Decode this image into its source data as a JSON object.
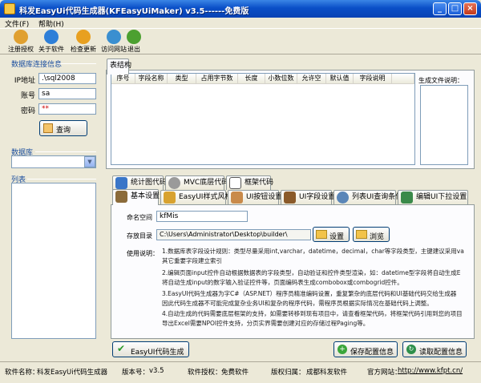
{
  "window": {
    "title": "科发EasyUi代码生成器(KFEasyUiMaker) v3.5------免费版",
    "min_glyph": "_",
    "max_glyph": "□",
    "close_glyph": "×"
  },
  "menu": {
    "items": [
      "文件(F)",
      "帮助(H)"
    ]
  },
  "toolbar": {
    "items": [
      {
        "label": "注册授权",
        "icon": "key-icon",
        "color": "#e0a030"
      },
      {
        "label": "关于软件",
        "icon": "help-icon",
        "color": "#2e7fd8"
      },
      {
        "label": "检查更新",
        "icon": "update-icon",
        "color": "#e8a020"
      },
      {
        "label": "访问网站",
        "icon": "globe-icon",
        "color": "#3a8fd0"
      },
      {
        "label": "退出",
        "icon": "exit-icon",
        "color": "#4ca030"
      }
    ]
  },
  "connection": {
    "group_title": "数据库连接信息",
    "ip_label": "IP地址",
    "ip_value": ".\\sql2008",
    "account_label": "账号",
    "account_value": "sa",
    "password_label": "密码",
    "password_value": "**",
    "query_button": "查询"
  },
  "database": {
    "group_title": "数据库",
    "selected": ""
  },
  "tables": {
    "group_title": "列表"
  },
  "table_structure": {
    "tab_label": "表结构",
    "columns": [
      "序号",
      "字段名称",
      "类型",
      "占用字节数",
      "长度",
      "小数位数",
      "允许空",
      "默认值",
      "字段说明"
    ]
  },
  "generated_files": {
    "label": "生成文件说明："
  },
  "tabs_row1": [
    {
      "label": "统计图代码",
      "icon": "chart-icon"
    },
    {
      "label": "MVC底层代码",
      "icon": "gear-icon"
    },
    {
      "label": "框架代码",
      "icon": "grid-icon"
    }
  ],
  "tabs_row2": [
    {
      "label": "基本设置",
      "icon": "home-icon"
    },
    {
      "label": "EasyUI样式风格",
      "icon": "palette-icon"
    },
    {
      "label": "UI按钮设置",
      "icon": "hand-icon"
    },
    {
      "label": "UI字段设置",
      "icon": "hammer-icon"
    },
    {
      "label": "列表UI查询条件",
      "icon": "magnifier-icon"
    },
    {
      "label": "编辑UI下拉设置",
      "icon": "pencil-icon"
    }
  ],
  "basic_settings": {
    "namespace_label": "命名空间",
    "namespace_value": "kfMis",
    "dir_label": "存放目录",
    "dir_value": "C:\\Users\\Administrator\\Desktop\\builder\\",
    "settings_button": "设置",
    "browse_button": "浏览",
    "desc_label": "使用说明：",
    "desc_lines": [
      "1.数据库表字段设计规则：类型尽量采用int,varchar，datetime，decimal，char等字段类型，主键建议采用va",
      "其它重要字段建立索引",
      "2.编辑页面input控件自动根据数据表的字段类型，自动验证和控件类型渲染，如：datetime型字段将自动生成E",
      "将自动生成input的数字输入验证控件等，页面编码表生成combobox或combogrid控件。",
      "3.EasyUI代码生成器为字C#（ASP.NET）程序员精准编码设置，重复繁杂的底层代码和UI基础代码交给生成器",
      "因此代码生成器不可能完成复杂业务UI和复杂的程序代码，需程序员根据实际情况在基础代码上调整。",
      "4.自动生成的代码需要底层框架的支持，如需要转移到现有项目中，请查看框架代码，将框架代码引用到您的项目",
      "导出Excel需要NPOI控件支持，分页实界需要创建对应的存储过程Paging等。"
    ]
  },
  "actions": {
    "generate": "EasyUI代码生成",
    "save_config": "保存配置信息",
    "load_config": "读取配置信息"
  },
  "status": {
    "name_label": "软件名称：",
    "name_value": "科发EasyUi代码生成器",
    "version_label": "版本号：",
    "version_value": "v3.5",
    "license_label": "软件授权：",
    "license_value": "免费软件",
    "copyright_label": "版权归属：",
    "copyright_value": "成都科发软件",
    "site_label": "官方网站：",
    "site_value": "http://www.kfpt.cn/"
  }
}
